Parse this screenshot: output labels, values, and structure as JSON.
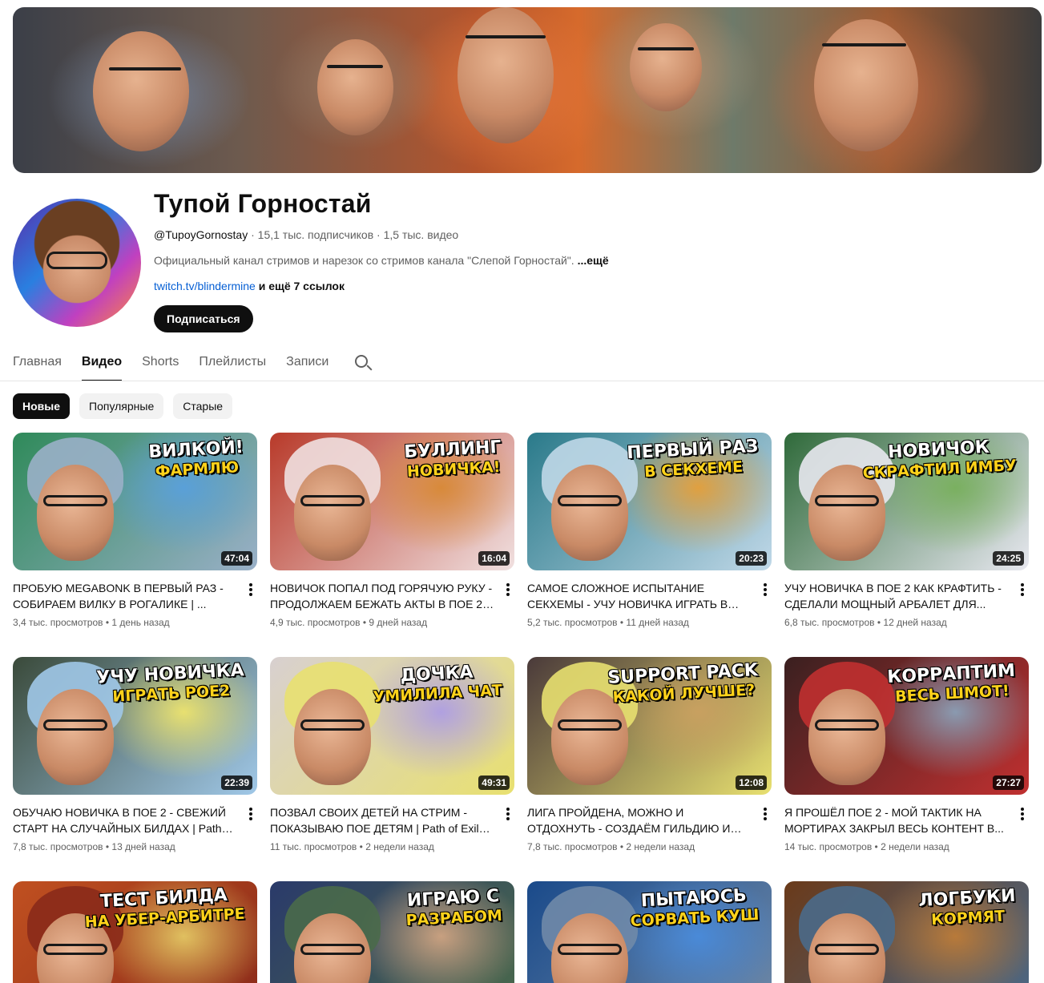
{
  "channel": {
    "name": "Тупой Горностай",
    "handle": "@TupoyGornostay",
    "sep1": " · ",
    "subscribers": "15,1 тыс. подписчиков",
    "sep2": " · ",
    "video_count": "1,5 тыс. видео",
    "description": "Официальный канал стримов и нарезок со стримов канала \"Слепой Горностай\". ",
    "more": "...ещё",
    "link": "twitch.tv/blindermine",
    "more_links": " и ещё 7 ссылок",
    "subscribe_label": "Подписаться"
  },
  "tabs": [
    "Главная",
    "Видео",
    "Shorts",
    "Плейлисты",
    "Записи"
  ],
  "active_tab": "Видео",
  "chips": [
    "Новые",
    "Популярные",
    "Старые"
  ],
  "active_chip": "Новые",
  "videos": [
    {
      "title": "ПРОБУЮ MEGABONK В ПЕРВЫЙ РАЗ - СОБИРАЕМ ВИЛКУ В РОГАЛИКЕ | ...",
      "views": "3,4 тыс. просмотров",
      "age": "1 день назад",
      "duration": "47:04",
      "thumb_line1": "ВИЛКОЙ!",
      "thumb_line2": "ФАРМЛЮ"
    },
    {
      "title": "НОВИЧОК ПОПАЛ ПОД ГОРЯЧУЮ РУКУ - ПРОДОЛЖАЕМ БЕЖАТЬ АКТЫ В ПОЕ 2 С...",
      "views": "4,9 тыс. просмотров",
      "age": "9 дней назад",
      "duration": "16:04",
      "thumb_line1": "БУЛЛИНГ",
      "thumb_line2": "НОВИЧКА!"
    },
    {
      "title": "САМОЕ СЛОЖНОЕ ИСПЫТАНИЕ СЕКХЕМЫ - УЧУ НОВИЧКА ИГРАТЬ В ПО...",
      "views": "5,2 тыс. просмотров",
      "age": "11 дней назад",
      "duration": "20:23",
      "thumb_line1": "ПЕРВЫЙ РАЗ",
      "thumb_line2": "В СЕКХЕМЕ"
    },
    {
      "title": "УЧУ НОВИЧКА В ПОЕ 2 КАК КРАФТИТЬ - СДЕЛАЛИ МОЩНЫЙ АРБАЛЕТ ДЛЯ...",
      "views": "6,8 тыс. просмотров",
      "age": "12 дней назад",
      "duration": "24:25",
      "thumb_line1": "НОВИЧОК",
      "thumb_line2": "СКРАФТИЛ ИМБУ"
    },
    {
      "title": "ОБУЧАЮ НОВИЧКА В ПОЕ 2 - СВЕЖИЙ СТАРТ НА СЛУЧАЙНЫХ БИЛДАХ | Path o...",
      "views": "7,8 тыс. просмотров",
      "age": "13 дней назад",
      "duration": "22:39",
      "thumb_line1": "УЧУ НОВИЧКА",
      "thumb_line2": "ИГРАТЬ POE2"
    },
    {
      "title": "ПОЗВАЛ СВОИХ ДЕТЕЙ НА СТРИМ - ПОКАЗЫВАЮ ПОЕ ДЕТЯМ | Path of Exile 2",
      "views": "11 тыс. просмотров",
      "age": "2 недели назад",
      "duration": "49:31",
      "thumb_line1": "ДОЧКА",
      "thumb_line2": "УМИЛИЛА ЧАТ"
    },
    {
      "title": "ЛИГА ПРОЙДЕНА, МОЖНО И ОТДОХНУТЬ - СОЗДАЁМ ГИЛЬДИЮ И ВЫБИРАЕМ...",
      "views": "7,8 тыс. просмотров",
      "age": "2 недели назад",
      "duration": "12:08",
      "thumb_line1": "SUPPORT PACK",
      "thumb_line2": "КАКОЙ ЛУЧШЕ?"
    },
    {
      "title": "Я ПРОШЁЛ ПОЕ 2 - МОЙ ТАКТИК НА МОРТИРАХ ЗАКРЫЛ ВЕСЬ КОНТЕНТ В...",
      "views": "14 тыс. просмотров",
      "age": "2 недели назад",
      "duration": "27:27",
      "thumb_line1": "КОРРАПТИМ",
      "thumb_line2": "ВЕСЬ ШМОТ!"
    },
    {
      "title": "",
      "views": "",
      "age": "",
      "duration": "",
      "thumb_line1": "ТЕСТ БИЛДА",
      "thumb_line2": "НА УБЕР-АРБИТРЕ"
    },
    {
      "title": "",
      "views": "",
      "age": "",
      "duration": "",
      "thumb_line1": "ИГРАЮ С",
      "thumb_line2": "РАЗРАБОМ"
    },
    {
      "title": "",
      "views": "",
      "age": "",
      "duration": "",
      "thumb_line1": "ПЫТАЮСЬ",
      "thumb_line2": "СОРВАТЬ КУШ"
    },
    {
      "title": "",
      "views": "",
      "age": "",
      "duration": "",
      "thumb_line1": "ЛОГБУКИ",
      "thumb_line2": "КОРМЯТ"
    }
  ],
  "meta_separator": " • ",
  "colors": {
    "accent": "#0f0f0f",
    "link": "#065fd4",
    "secondary_text": "#606060",
    "chip_bg": "#f2f2f2"
  },
  "icons": {
    "search": "search-icon",
    "more": "more-vert-icon"
  }
}
